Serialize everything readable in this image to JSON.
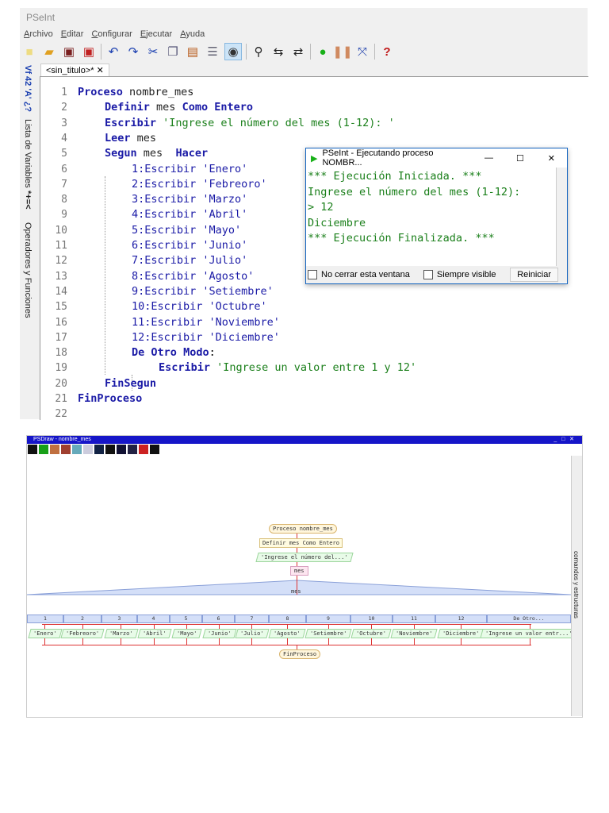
{
  "app": {
    "title": "PSeInt",
    "menu": [
      "Archivo",
      "Editar",
      "Configurar",
      "Ejecutar",
      "Ayuda"
    ],
    "tab": "<sin_titulo>*",
    "tab_close": "✕",
    "side_panels": [
      "Lista de Variables",
      "Operadores y Funciones"
    ],
    "side_icons": [
      "Vf 42 'A' ¿?",
      "*+=<"
    ]
  },
  "code": [
    {
      "n": "1",
      "t": "Proceso nombre_mes"
    },
    {
      "n": "2",
      "t": "Definir mes Como Entero"
    },
    {
      "n": "3",
      "t": "Escribir 'Ingrese el número del mes (1-12): '"
    },
    {
      "n": "4",
      "t": "Leer mes"
    },
    {
      "n": "5",
      "t": "Segun mes  Hacer"
    },
    {
      "n": "6",
      "t": "1:Escribir 'Enero'"
    },
    {
      "n": "7",
      "t": "2:Escribir 'Febreoro'"
    },
    {
      "n": "8",
      "t": "3:Escribir 'Marzo'"
    },
    {
      "n": "9",
      "t": "4:Escribir 'Abril'"
    },
    {
      "n": "10",
      "t": "5:Escribir 'Mayo'"
    },
    {
      "n": "11",
      "t": "6:Escribir 'Junio'"
    },
    {
      "n": "12",
      "t": "7:Escribir 'Julio'"
    },
    {
      "n": "13",
      "t": "8:Escribir 'Agosto'"
    },
    {
      "n": "14",
      "t": "9:Escribir 'Setiembre'"
    },
    {
      "n": "15",
      "t": "10:Escribir 'Octubre'"
    },
    {
      "n": "16",
      "t": "11:Escribir 'Noviembre'"
    },
    {
      "n": "17",
      "t": "12:Escribir 'Diciembre'"
    },
    {
      "n": "18",
      "t": "De Otro Modo:"
    },
    {
      "n": "19",
      "t": "Escribir 'Ingrese un valor entre 1 y 12'"
    },
    {
      "n": "20",
      "t": "FinSegun"
    },
    {
      "n": "21",
      "t": "FinProceso"
    },
    {
      "n": "22",
      "t": ""
    }
  ],
  "console": {
    "title": "PSeInt - Ejecutando proceso NOMBR...",
    "lines": [
      "*** Ejecución Iniciada. ***",
      "Ingrese el número del mes (1-12):",
      "> 12",
      "Diciembre",
      "*** Ejecución Finalizada. ***"
    ],
    "no_cerrar": "No cerrar esta ventana",
    "siempre_visible": "Siempre visible",
    "reiniciar": "Reiniciar"
  },
  "psdraw": {
    "title": "PSDraw - nombre_mes",
    "side_panel": "comandos y estructuras",
    "start": "Proceso nombre_mes",
    "define": "Definir mes Como Entero",
    "write": "'Ingrese el número del...'",
    "read": "mes",
    "switch_var": "mes",
    "cases": [
      "1",
      "2",
      "3",
      "4",
      "5",
      "6",
      "7",
      "8",
      "9",
      "10",
      "11",
      "12",
      "De Otro..."
    ],
    "outputs": [
      "'Enero'",
      "'Febreoro'",
      "'Marzo'",
      "'Abril'",
      "'Mayo'",
      "'Junio'",
      "'Julio'",
      "'Agosto'",
      "'Setiembre'",
      "'Octubre'",
      "'Noviembre'",
      "'Diciembre'",
      "'Ingrese un valor entr...'"
    ],
    "end": "FinProceso"
  }
}
